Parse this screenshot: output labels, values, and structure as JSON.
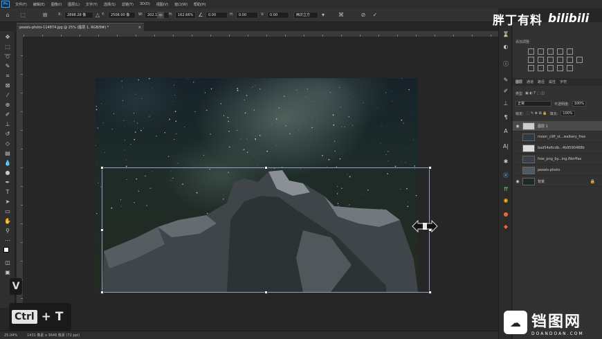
{
  "app": {
    "logo": "Ps"
  },
  "menu": [
    "文件(F)",
    "编辑(E)",
    "图像(I)",
    "图层(L)",
    "文字(Y)",
    "选择(S)",
    "滤镜(T)",
    "3D(D)",
    "视图(V)",
    "窗口(W)",
    "帮助(H)"
  ],
  "options": {
    "x_label": "X:",
    "x_value": "2898.28 像",
    "y_label": "Y:",
    "y_value": "2508.00 像",
    "w_label": "W:",
    "w_value": "202.12%",
    "h_label": "H:",
    "h_value": "162.66%",
    "angle_value": "0.00",
    "hskew_label": "H:",
    "hskew_value": "0.00",
    "vskew_label": "V:",
    "vskew_value": "0.00",
    "interp_value": "两次立方",
    "cancel_icon": "cancel-icon",
    "commit_icon": "commit-check-icon"
  },
  "document_tab": {
    "title": "pexels-photo-114874.jpg @ 25% (图层 1, RGB/8#) *",
    "close": "×"
  },
  "tools": [
    "move-icon",
    "marquee-icon",
    "lasso-icon",
    "quick-select-icon",
    "crop-icon",
    "frame-icon",
    "eyedropper-icon",
    "healing-icon",
    "brush-icon",
    "stamp-icon",
    "history-brush-icon",
    "eraser-icon",
    "gradient-icon",
    "blur-icon",
    "dodge-icon",
    "pen-icon",
    "type-icon",
    "path-select-icon",
    "shape-icon",
    "hand-icon",
    "zoom-icon",
    "more-icon",
    "color-swatch",
    "quick-mask-icon",
    "screen-mode-icon"
  ],
  "status": {
    "zoom": "25.04%",
    "doc_info": "1431 像素 x 3646 像素 (72 ppi)"
  },
  "overlay": {
    "key_v": "V",
    "key_ctrl": "Ctrl",
    "plus": "+",
    "key_t": "T"
  },
  "watermark": {
    "name": "胖丁有料",
    "site": "bilibili"
  },
  "right_panel": {
    "adjustments_title": "添加调整",
    "layer_tabs": [
      "图层",
      "通道",
      "路径",
      "属性",
      "字符"
    ],
    "kind_label": "类型",
    "blend_mode": "正常",
    "opacity_label": "不透明度:",
    "opacity_value": "100%",
    "lock_label": "锁定:",
    "fill_label": "填充:",
    "fill_value": "100%",
    "layers": [
      {
        "name": "图层 1",
        "visible": true,
        "selected": true,
        "thumb": "#c9cdd0"
      },
      {
        "name": "moon_cliff_st...walkery_free",
        "visible": false,
        "selected": false,
        "thumb": "#2f3b44"
      },
      {
        "name": "bad54e6cdb...4b9590488b",
        "visible": false,
        "selected": false,
        "thumb": "#d9dde0"
      },
      {
        "name": "free_png_by...ing.iNorffas",
        "visible": false,
        "selected": false,
        "thumb": "#38414a"
      },
      {
        "name": "pexels-photo",
        "visible": false,
        "selected": false,
        "thumb": "#4f5a62"
      },
      {
        "name": "背景",
        "visible": true,
        "selected": false,
        "thumb": "#1d2a2a",
        "locked": true
      }
    ]
  },
  "bottom_logo": {
    "badge": "☁",
    "name": "铛图网",
    "url": "DOANDOAN.COM"
  },
  "colors": {
    "bg": "#262626",
    "panel": "#323232",
    "accent": "#31a8ff",
    "transform_box": "#8fa3c7"
  }
}
